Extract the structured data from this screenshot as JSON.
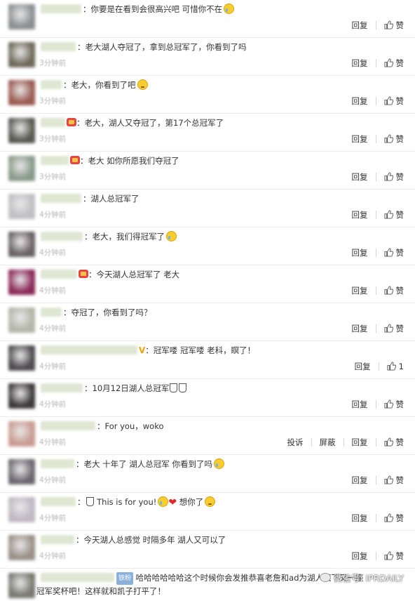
{
  "labels": {
    "reply": "回复",
    "like": "赞",
    "report": "投诉",
    "block": "屏蔽"
  },
  "comments": [
    {
      "avatar_color": "#8b8f92",
      "name_w": 58,
      "text": "：你要是在看到会很高兴吧 可惜你不在",
      "emoji": "cry",
      "time": "",
      "likes": ""
    },
    {
      "avatar_color": "#6e6a5a",
      "name_w": 50,
      "text": "：老大湖人夺冠了，拿到总冠军了，你看到了吗",
      "emoji": "",
      "time": "3分钟前",
      "likes": ""
    },
    {
      "avatar_color": "#9b5b52",
      "name_w": 30,
      "text": "：老大，你看到了吧",
      "emoji": "awk",
      "time": "3分钟前",
      "likes": ""
    },
    {
      "avatar_color": "#5a5a52",
      "name_w": 35,
      "text": "：老大，湖人又夺冠了，第17个总冠军了",
      "emoji": "",
      "time": "3分钟前",
      "likes": "",
      "badge": "crown"
    },
    {
      "avatar_color": "#8a9a8a",
      "name_w": 40,
      "text": "：老大  如你所愿我们夺冠了",
      "emoji": "",
      "time": "3分钟前",
      "likes": "",
      "badge": "crown"
    },
    {
      "avatar_color": "#c0c0c4",
      "name_w": 58,
      "text": "：湖人总冠军了",
      "emoji": "",
      "time": "4分钟前",
      "likes": ""
    },
    {
      "avatar_color": "#6a6264",
      "name_w": 60,
      "text": "：老大，我们得冠军了",
      "emoji": "cry",
      "time": "4分钟前",
      "likes": ""
    },
    {
      "avatar_color": "#8c2b5a",
      "name_w": 52,
      "text": "：今天湖人总冠军了 老大",
      "emoji": "",
      "time": "4分钟前",
      "likes": "",
      "badge": "crown"
    },
    {
      "avatar_color": "#b3b6a8",
      "name_w": 30,
      "text": "：夺冠了，你看到了吗？",
      "emoji": "",
      "time": "4分钟前",
      "likes": ""
    },
    {
      "avatar_color": "#4e4c4e",
      "name_w": 138,
      "text": "：冠军喽  冠军喽   老科，瞑了！",
      "emoji": "",
      "time": "4分钟前",
      "likes": "1",
      "badge": "v"
    },
    {
      "avatar_color": "#3e3a3c",
      "name_w": 60,
      "text": "：10月12日湖人总冠军",
      "emoji": "",
      "time": "4分钟前",
      "likes": "",
      "cups": true
    },
    {
      "avatar_color": "#c99c92",
      "name_w": 78,
      "text": "：For you，woko",
      "emoji": "",
      "time": "4分钟前",
      "likes": "",
      "extra": true
    },
    {
      "avatar_color": "#6c6870",
      "name_w": 48,
      "text": "：老大 十年了 湖人总冠军 你看到了吗",
      "emoji": "cry",
      "time": "4分钟前",
      "likes": ""
    },
    {
      "avatar_color": "#c0b8c4",
      "name_w": 50,
      "text": "This is for you!",
      "emoji": "",
      "time": "4分钟前",
      "likes": "",
      "special": true,
      "tail": "想你了"
    },
    {
      "avatar_color": "#9a9088",
      "name_w": 48,
      "text": "：今天湖人总感觉 时隔多年 湖人又可以了",
      "emoji": "",
      "time": "4分钟前",
      "likes": ""
    }
  ],
  "last_comment": {
    "avatar_color": "#7a7a72",
    "level": "铁粉",
    "text": "哈哈哈哈哈哈这个时候你会发推恭喜老詹和ad为湖人赢下又一座",
    "line2": "冠军奖杯吧！这样就和凯子打平了！"
  },
  "watermark": "微信号: IPRDAILY"
}
